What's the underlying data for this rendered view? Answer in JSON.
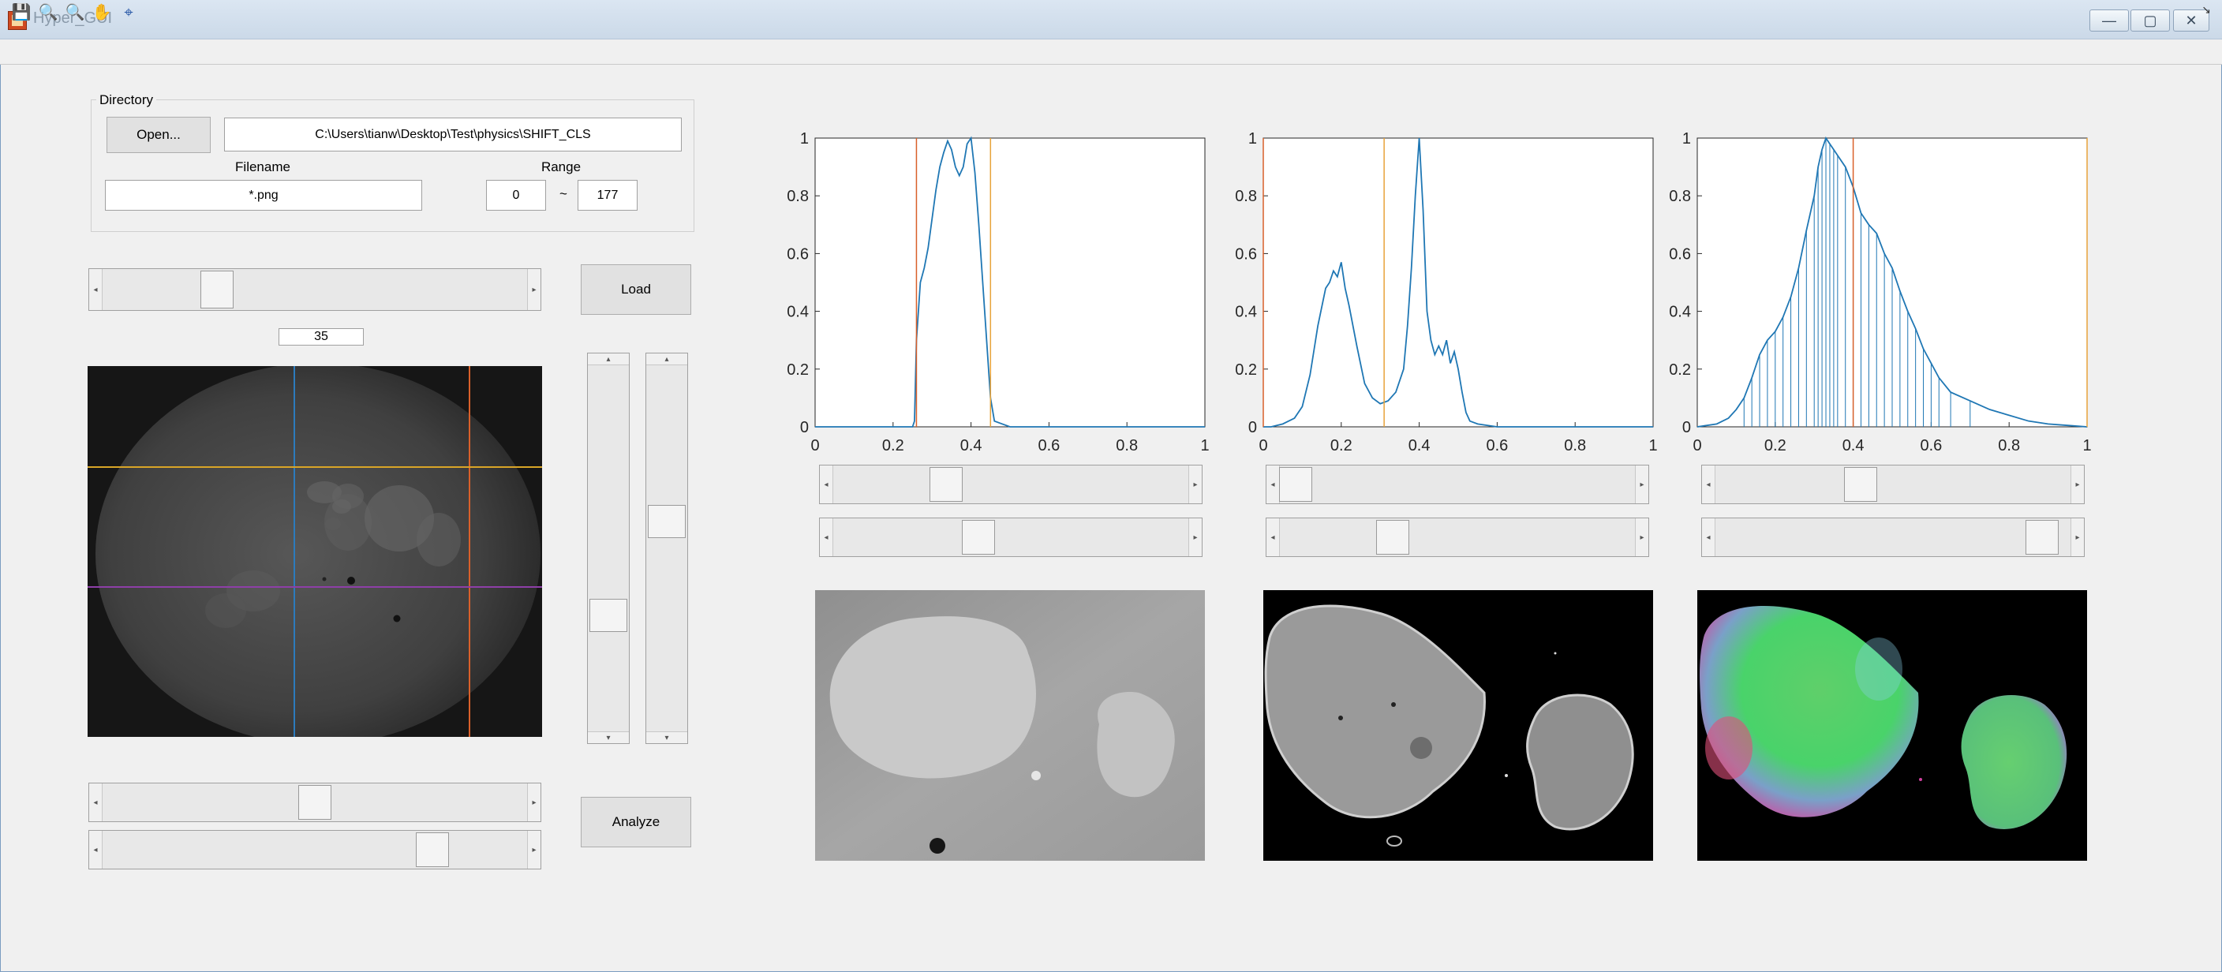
{
  "window": {
    "title": "Hyper_GUI",
    "minimize": "—",
    "maximize": "▢",
    "close": "✕"
  },
  "toolbar": {
    "items": [
      {
        "name": "save-icon",
        "glyph": "💾"
      },
      {
        "name": "zoom-in-icon",
        "glyph": "🔍"
      },
      {
        "name": "zoom-out-icon",
        "glyph": "🔍"
      },
      {
        "name": "pan-hand-icon",
        "glyph": "✋"
      },
      {
        "name": "data-cursor-icon",
        "glyph": "⌖"
      }
    ],
    "dock_glyph": "↘"
  },
  "directory": {
    "title": "Directory",
    "open_label": "Open...",
    "path": "C:\\Users\\tianw\\Desktop\\Test\\physics\\SHIFT_CLS",
    "filename_label": "Filename",
    "filename": "*.png",
    "range_label": "Range",
    "range_from": "0",
    "range_sep": "~",
    "range_to": "177"
  },
  "controls": {
    "load_label": "Load",
    "analyze_label": "Analyze",
    "frame_value": "35",
    "frame_slider": 0.25,
    "v_slider_1": 0.7,
    "v_slider_2": 0.42,
    "h_slider_1": 0.5,
    "h_slider_2": 0.8
  },
  "viewer": {
    "crosshair_colors": {
      "vertical_1": "#2c7bbd",
      "vertical_2": "#d9602a",
      "horizontal_1": "#d9a527",
      "horizontal_2": "#8e3fa8"
    }
  },
  "plots": {
    "line_color": "#1f77b4",
    "marker_a_color": "#d9602a",
    "marker_b_color": "#e8a33a",
    "panels": [
      {
        "slider_top": 0.3,
        "slider_bottom": 0.4
      },
      {
        "slider_top": 0.0,
        "slider_bottom": 0.3
      },
      {
        "slider_top": 0.4,
        "slider_bottom": 0.96
      }
    ]
  },
  "chart_data": [
    {
      "type": "line",
      "x": [
        0,
        0.1,
        0.2,
        0.25,
        0.255,
        0.26,
        0.27,
        0.28,
        0.29,
        0.3,
        0.31,
        0.32,
        0.33,
        0.34,
        0.35,
        0.36,
        0.37,
        0.38,
        0.39,
        0.4,
        0.41,
        0.42,
        0.43,
        0.44,
        0.45,
        0.46,
        0.5,
        0.6,
        0.8,
        1
      ],
      "series": [
        {
          "values": [
            0,
            0,
            0,
            0,
            0.02,
            0.3,
            0.5,
            0.55,
            0.62,
            0.72,
            0.82,
            0.9,
            0.95,
            0.99,
            0.96,
            0.9,
            0.87,
            0.9,
            0.98,
            1.0,
            0.88,
            0.7,
            0.5,
            0.3,
            0.1,
            0.02,
            0,
            0,
            0,
            0
          ]
        }
      ],
      "markers": [
        0.26,
        0.45
      ],
      "xlim": [
        0,
        1
      ],
      "ylim": [
        0,
        1
      ],
      "xticks": [
        "0",
        "0.2",
        "0.4",
        "0.6",
        "0.8",
        "1"
      ],
      "yticks": [
        "0",
        "0.2",
        "0.4",
        "0.6",
        "0.8",
        "1"
      ]
    },
    {
      "type": "line",
      "x": [
        0,
        0.02,
        0.05,
        0.08,
        0.1,
        0.12,
        0.14,
        0.16,
        0.17,
        0.18,
        0.19,
        0.2,
        0.21,
        0.22,
        0.24,
        0.26,
        0.28,
        0.3,
        0.32,
        0.34,
        0.36,
        0.37,
        0.38,
        0.39,
        0.4,
        0.41,
        0.42,
        0.43,
        0.44,
        0.45,
        0.46,
        0.47,
        0.48,
        0.49,
        0.5,
        0.51,
        0.52,
        0.53,
        0.55,
        0.6,
        0.8,
        1
      ],
      "series": [
        {
          "values": [
            0,
            0,
            0.01,
            0.03,
            0.07,
            0.18,
            0.35,
            0.48,
            0.5,
            0.54,
            0.52,
            0.57,
            0.48,
            0.42,
            0.28,
            0.15,
            0.1,
            0.08,
            0.09,
            0.12,
            0.2,
            0.35,
            0.55,
            0.8,
            1.0,
            0.75,
            0.4,
            0.3,
            0.25,
            0.28,
            0.25,
            0.3,
            0.22,
            0.26,
            0.2,
            0.12,
            0.05,
            0.02,
            0.01,
            0,
            0,
            0
          ]
        }
      ],
      "markers": [
        0.0,
        0.31
      ],
      "xlim": [
        0,
        1
      ],
      "ylim": [
        0,
        1
      ],
      "xticks": [
        "0",
        "0.2",
        "0.4",
        "0.6",
        "0.8",
        "1"
      ],
      "yticks": [
        "0",
        "0.2",
        "0.4",
        "0.6",
        "0.8",
        "1"
      ]
    },
    {
      "type": "line",
      "x": [
        0,
        0.05,
        0.08,
        0.1,
        0.12,
        0.14,
        0.16,
        0.18,
        0.2,
        0.22,
        0.24,
        0.26,
        0.28,
        0.3,
        0.31,
        0.32,
        0.33,
        0.34,
        0.35,
        0.36,
        0.38,
        0.4,
        0.42,
        0.44,
        0.46,
        0.48,
        0.5,
        0.52,
        0.54,
        0.56,
        0.58,
        0.6,
        0.62,
        0.65,
        0.7,
        0.75,
        0.8,
        0.85,
        0.9,
        0.95,
        1
      ],
      "series": [
        {
          "values": [
            0,
            0.01,
            0.03,
            0.06,
            0.1,
            0.17,
            0.25,
            0.3,
            0.33,
            0.38,
            0.45,
            0.55,
            0.68,
            0.8,
            0.9,
            0.96,
            1.0,
            0.98,
            0.96,
            0.94,
            0.9,
            0.83,
            0.74,
            0.7,
            0.67,
            0.6,
            0.55,
            0.47,
            0.4,
            0.34,
            0.27,
            0.22,
            0.17,
            0.12,
            0.09,
            0.06,
            0.04,
            0.02,
            0.01,
            0.005,
            0
          ]
        }
      ],
      "markers": [
        0.4,
        1.0
      ],
      "xlim": [
        0,
        1
      ],
      "ylim": [
        0,
        1
      ],
      "xticks": [
        "0",
        "0.2",
        "0.4",
        "0.6",
        "0.8",
        "1"
      ],
      "yticks": [
        "0",
        "0.2",
        "0.4",
        "0.6",
        "0.8",
        "1"
      ]
    }
  ]
}
